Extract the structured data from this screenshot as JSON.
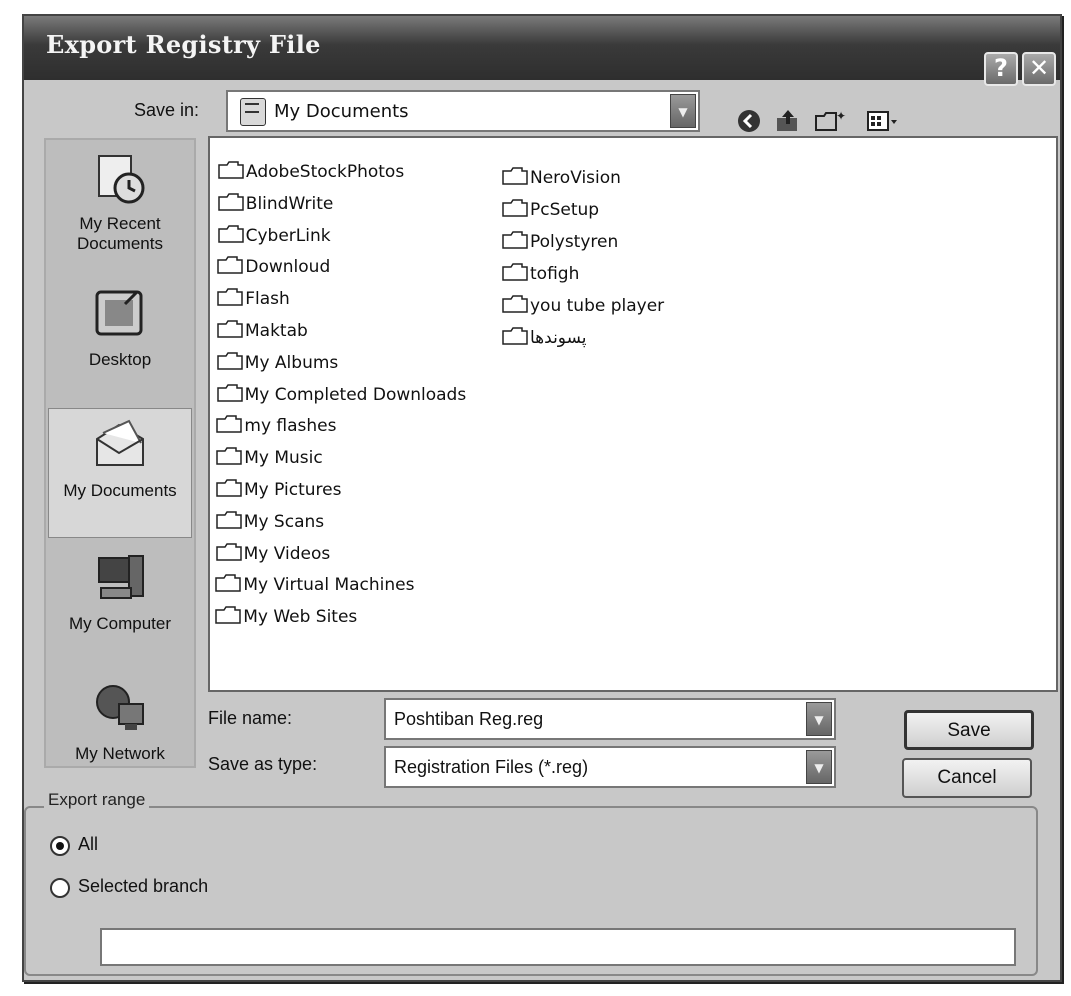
{
  "window": {
    "title": "Export Registry File",
    "help_glyph": "?",
    "close_glyph": "✕"
  },
  "savein": {
    "label": "Save in:",
    "value": "My Documents"
  },
  "toolbar": {
    "back_icon": "back-icon",
    "up_icon": "up-folder-icon",
    "newfolder_icon": "new-folder-icon",
    "views_icon": "views-menu-icon"
  },
  "places": [
    {
      "label": "My Recent Documents",
      "icon": "recent-documents-icon"
    },
    {
      "label": "Desktop",
      "icon": "desktop-icon"
    },
    {
      "label": "My Documents",
      "icon": "my-documents-icon",
      "selected": true
    },
    {
      "label": "My Computer",
      "icon": "my-computer-icon"
    },
    {
      "label": "My Network",
      "icon": "my-network-icon"
    }
  ],
  "files": {
    "col1": [
      "AdobeStockPhotos",
      "BlindWrite",
      "CyberLink",
      "Downloud",
      "Flash",
      "Maktab",
      "My Albums",
      "My Completed Downloads",
      "my flashes",
      "My Music",
      "My Pictures",
      "My Scans",
      "My Videos",
      "My Virtual Machines",
      "My Web Sites"
    ],
    "col2": [
      "NeroVision",
      "PcSetup",
      "Polystyren",
      "tofigh",
      "you tube player",
      "پسوندها"
    ]
  },
  "filename": {
    "label": "File name:",
    "value": "Poshtiban Reg.reg"
  },
  "savetype": {
    "label": "Save as type:",
    "value": "Registration Files (*.reg)"
  },
  "buttons": {
    "save": "Save",
    "cancel": "Cancel"
  },
  "export_range": {
    "legend": "Export range",
    "all": "All",
    "selected_branch": "Selected branch",
    "branch_value": ""
  }
}
